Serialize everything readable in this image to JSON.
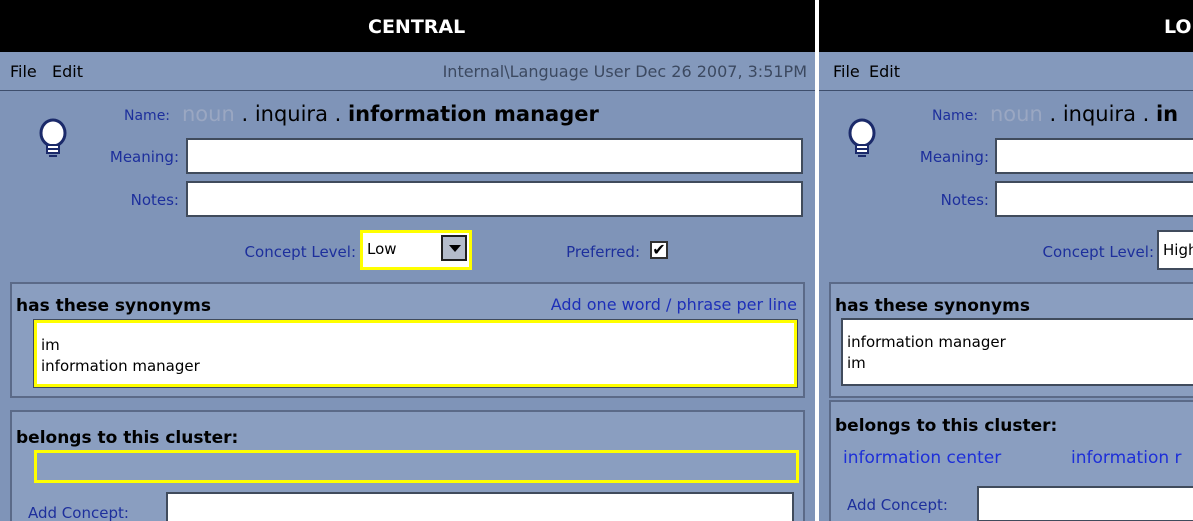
{
  "central": {
    "title": "CENTRAL",
    "menu": [
      "File",
      "Edit"
    ],
    "status": "Internal\\Language User   Dec 26 2007, 3:51PM",
    "name_label": "Name:",
    "name": {
      "pos": "noun",
      "sep1": " . ",
      "domain": "inquira",
      "sep2": " . ",
      "term": "information manager"
    },
    "meaning_label": "Meaning:",
    "meaning_value": "",
    "notes_label": "Notes:",
    "notes_value": "",
    "concept_level_label": "Concept Level:",
    "concept_level_value": "Low",
    "preferred_label": "Preferred:",
    "preferred_checked": "✔",
    "synonyms_title": "has these synonyms",
    "synonyms_hint": "Add one word / phrase per line",
    "synonyms": [
      "im",
      "information manager"
    ],
    "cluster_title": "belongs to this cluster:",
    "add_concept_label": "Add Concept:"
  },
  "local": {
    "title": "LO",
    "menu": [
      "File",
      "Edit"
    ],
    "name_label": "Name:",
    "name": {
      "pos": "noun",
      "sep1": " . ",
      "domain": "inquira",
      "sep2": " . ",
      "term": "in"
    },
    "meaning_label": "Meaning:",
    "notes_label": "Notes:",
    "concept_level_label": "Concept Level:",
    "concept_level_value": "High",
    "synonyms_title": "has these synonyms",
    "synonyms": [
      "information manager",
      "im"
    ],
    "cluster_title": "belongs to this cluster:",
    "cluster_links": [
      "information center",
      "information r"
    ],
    "add_concept_label": "Add Concept:"
  },
  "colors": {
    "panel": "#7f94b8",
    "titlebar": "#000000",
    "highlight": "#ffff00",
    "link": "#1d2fd8"
  }
}
